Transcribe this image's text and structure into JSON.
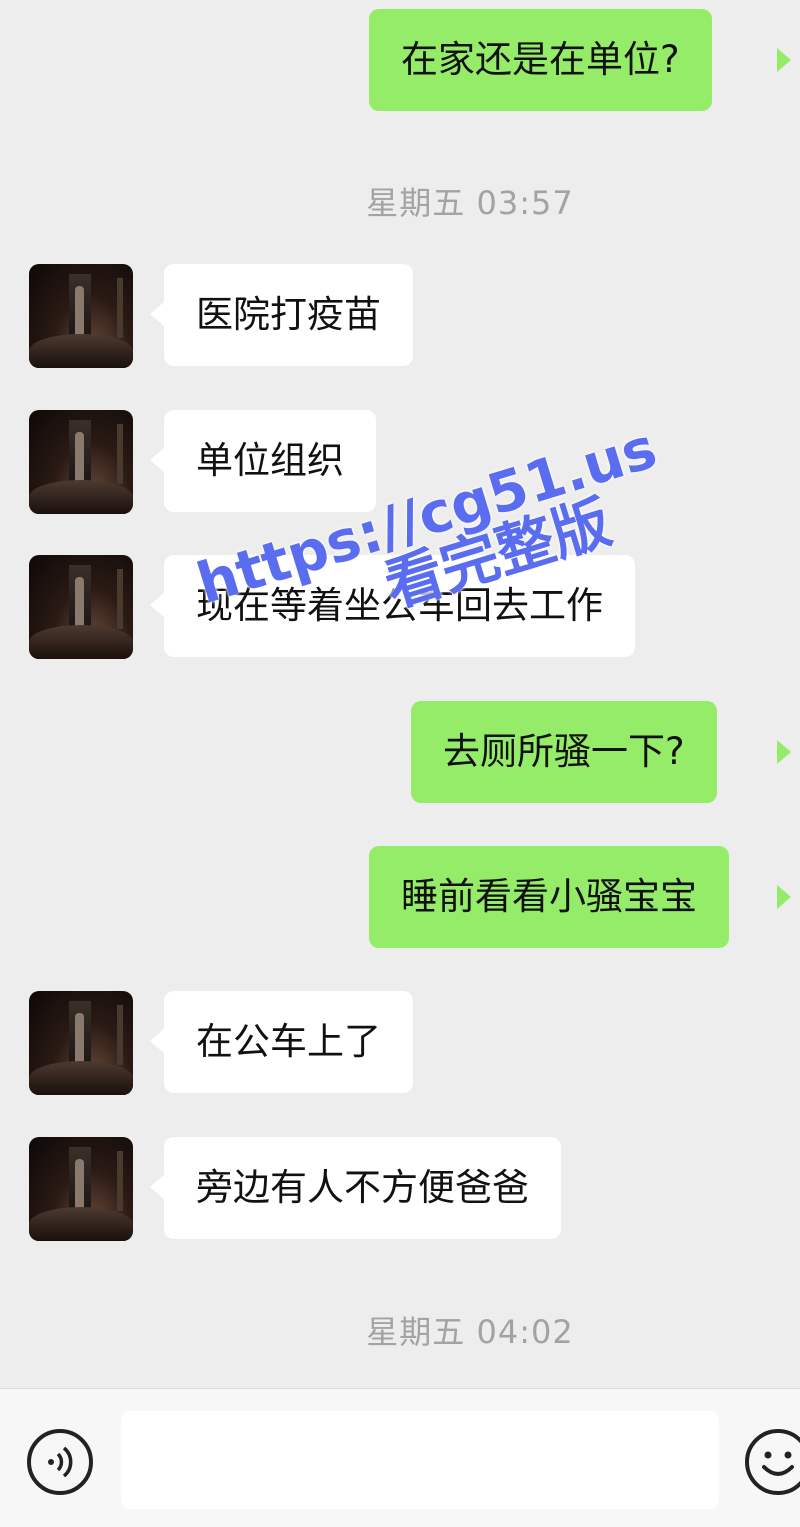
{
  "messages": [
    {
      "side": "out",
      "text": "在家还是在单位?"
    },
    {
      "side": "in",
      "text": "医院打疫苗"
    },
    {
      "side": "in",
      "text": "单位组织"
    },
    {
      "side": "in",
      "text": "现在等着坐公车回去工作"
    },
    {
      "side": "out",
      "text": "去厕所骚一下?"
    },
    {
      "side": "out",
      "text": "睡前看看小骚宝宝"
    },
    {
      "side": "in",
      "text": "在公车上了"
    },
    {
      "side": "in",
      "text": "旁边有人不方便爸爸"
    }
  ],
  "timestamps": [
    "星期五 03:57",
    "星期五 04:02"
  ],
  "watermark": {
    "line1": "https://cg51.us",
    "line2": "看完整版"
  },
  "input_bar": {
    "voice_icon": "voice-wave-icon",
    "emoji_icon": "smiley-icon",
    "text_value": ""
  },
  "colors": {
    "background": "#ededed",
    "incoming_bubble": "#ffffff",
    "outgoing_bubble": "#95ec69",
    "timestamp_text": "#a3a3a3",
    "watermark": "#5a6df0"
  }
}
